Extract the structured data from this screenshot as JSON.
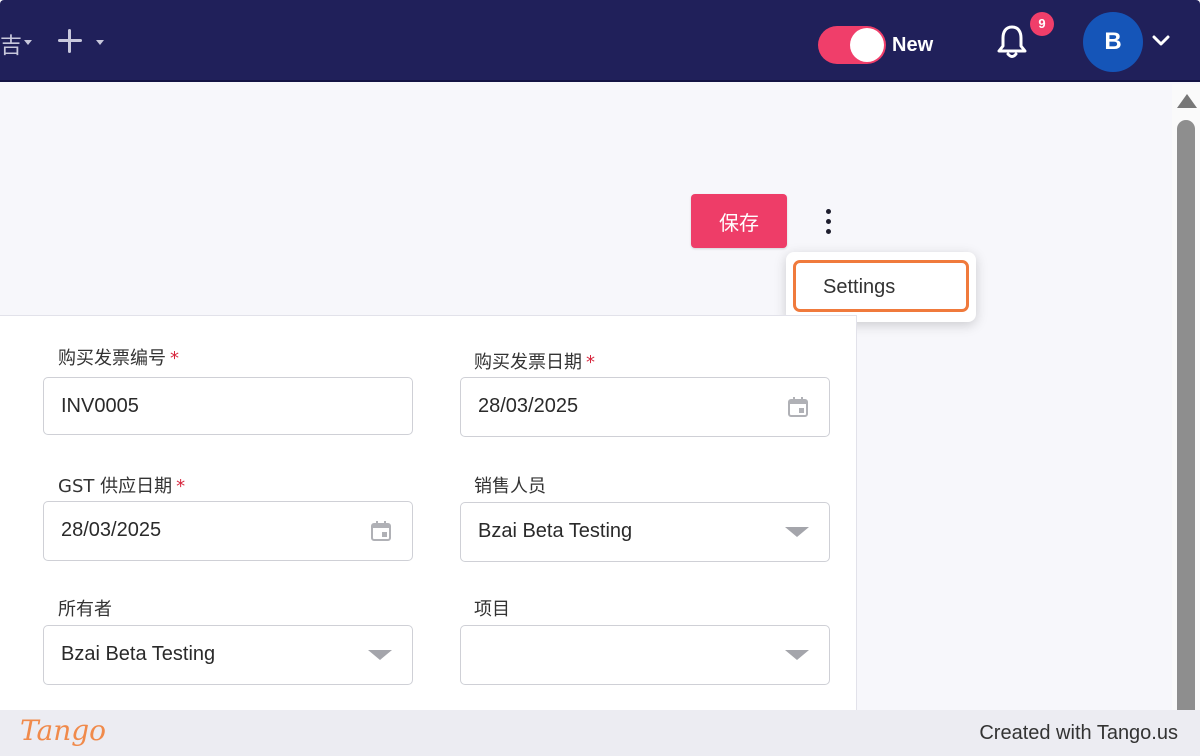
{
  "topbar": {
    "partial_menu_text": "吉",
    "new_toggle_label": "New",
    "notification_count": "9",
    "avatar_initial": "B",
    "colors": {
      "bar": "#20205a",
      "accent": "#f03e6a",
      "avatar": "#1555b8"
    }
  },
  "actions": {
    "save_label": "保存",
    "menu": {
      "settings_label": "Settings"
    }
  },
  "form": {
    "invoice_no": {
      "label": "购买发票编号",
      "required": "*",
      "value": "INV0005"
    },
    "invoice_date": {
      "label": "购买发票日期",
      "required": "*",
      "value": "28/03/2025"
    },
    "gst_date": {
      "label": "GST 供应日期",
      "required": "*",
      "value": "28/03/2025"
    },
    "salesperson": {
      "label": "销售人员",
      "value": "Bzai Beta Testing"
    },
    "owner": {
      "label": "所有者",
      "value": "Bzai Beta Testing"
    },
    "project": {
      "label": "项目",
      "value": ""
    }
  },
  "footer": {
    "logo": "Tango",
    "credit": "Created with Tango.us"
  }
}
